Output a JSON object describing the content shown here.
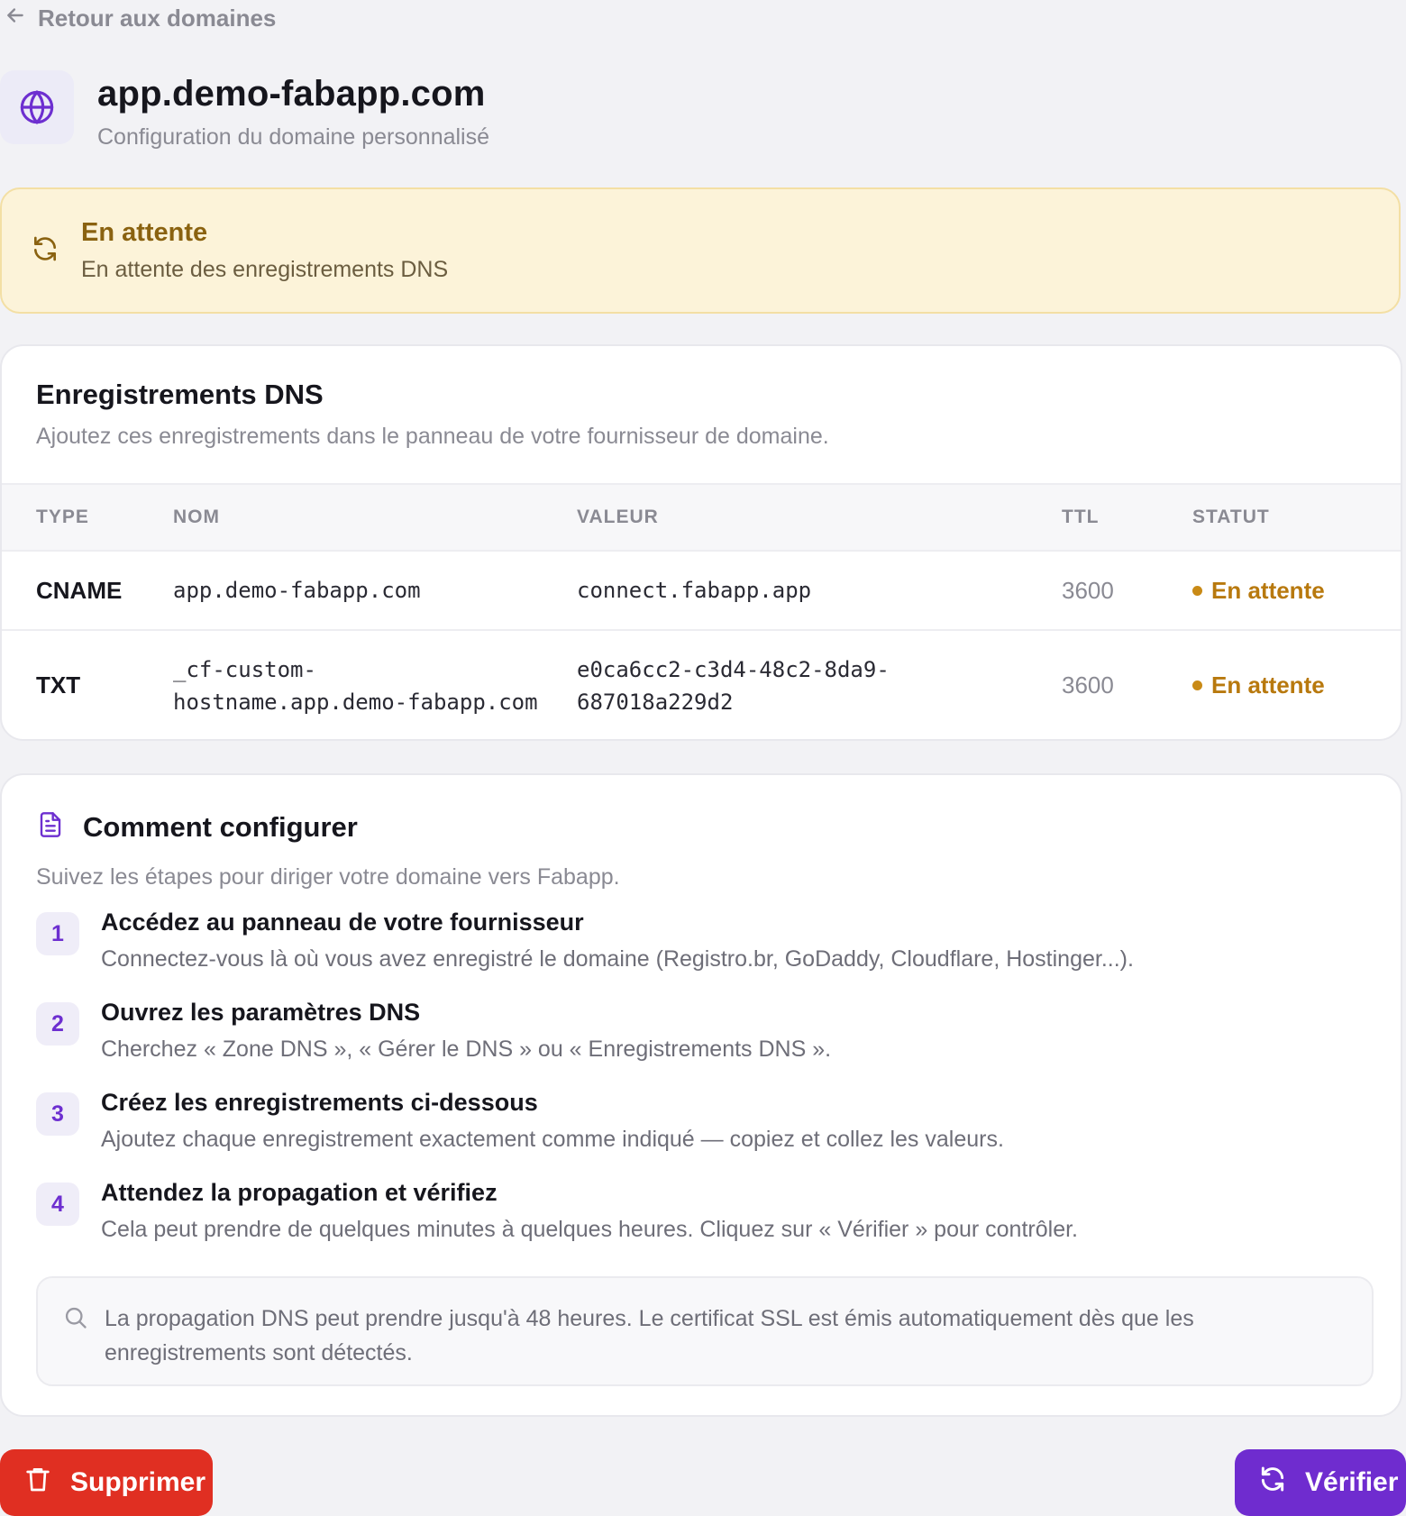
{
  "nav": {
    "back_label": "Retour aux domaines",
    "back_icon": "arrow-left-icon"
  },
  "header": {
    "icon": "globe-icon",
    "domain": "app.demo-fabapp.com",
    "subtitle": "Configuration du domaine personnalisé"
  },
  "banner": {
    "icon": "refresh-icon",
    "title": "En attente",
    "subtitle": "En attente des enregistrements DNS"
  },
  "dns": {
    "title": "Enregistrements DNS",
    "subtitle": "Ajoutez ces enregistrements dans le panneau de votre fournisseur de domaine.",
    "columns": [
      "TYPE",
      "NOM",
      "VALEUR",
      "TTL",
      "STATUT"
    ],
    "records": [
      {
        "type": "CNAME",
        "name": "app.demo-fabapp.com",
        "value": "connect.fabapp.app",
        "ttl": "3600",
        "status": "En attente"
      },
      {
        "type": "TXT",
        "name_line1": "_cf-custom-",
        "name_line2": "hostname.app.demo-fabapp.com",
        "value_line1": "e0ca6cc2-c3d4-48c2-8da9-",
        "value_line2": "687018a229d2",
        "ttl": "3600",
        "status": "En attente"
      }
    ]
  },
  "howto": {
    "icon": "document-icon",
    "title": "Comment configurer",
    "subtitle": "Suivez les étapes pour diriger votre domaine vers Fabapp.",
    "steps": [
      {
        "num": "1",
        "title": "Accédez au panneau de votre fournisseur",
        "desc": "Connectez-vous là où vous avez enregistré le domaine (Registro.br, GoDaddy, Cloudflare, Hostinger...)."
      },
      {
        "num": "2",
        "title": "Ouvrez les paramètres DNS",
        "desc": "Cherchez « Zone DNS », « Gérer le DNS » ou « Enregistrements DNS »."
      },
      {
        "num": "3",
        "title": "Créez les enregistrements ci-dessous",
        "desc": "Ajoutez chaque enregistrement exactement comme indiqué — copiez et collez les valeurs."
      },
      {
        "num": "4",
        "title": "Attendez la propagation et vérifiez",
        "desc": "Cela peut prendre de quelques minutes à quelques heures. Cliquez sur « Vérifier » pour contrôler."
      }
    ],
    "note": {
      "icon": "search-icon",
      "text": "La propagation DNS peut prendre jusqu'à 48 heures. Le certificat SSL est émis automatiquement dès que les enregistrements sont détectés."
    }
  },
  "actions": {
    "delete_label": "Supprimer",
    "delete_icon": "trash-icon",
    "verify_label": "Vérifier",
    "verify_icon": "refresh-icon"
  },
  "colors": {
    "accent": "#6f2ccf",
    "danger": "#e02f22",
    "pending": "#b8790e",
    "banner_bg": "#fcf3d9"
  }
}
